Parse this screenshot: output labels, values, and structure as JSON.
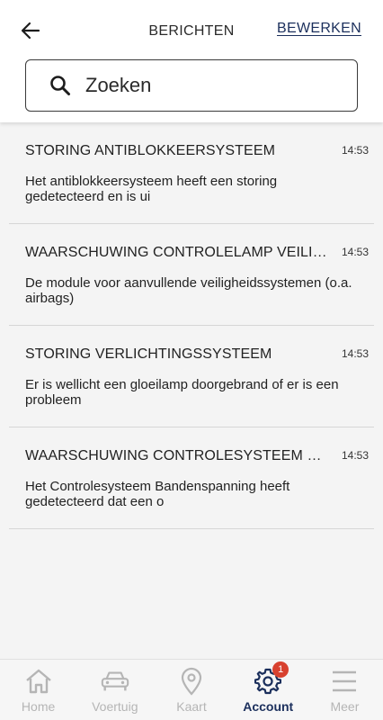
{
  "header": {
    "title": "BERICHTEN",
    "edit_label": "BEWERKEN",
    "back_icon": "arrow-left-icon"
  },
  "search": {
    "placeholder": "Zoeken",
    "value": "",
    "icon": "search-icon"
  },
  "messages": [
    {
      "title": "STORING ANTIBLOKKEERSYSTEEM",
      "time": "14:53",
      "body": "Het antiblokkeersysteem heeft een storing gedetecteerd en is ui"
    },
    {
      "title": "WAARSCHUWING CONTROLELAMP VEILIGHEIDS...",
      "time": "14:53",
      "body": "De module  voor aanvullende veiligheidssystemen (o.a. airbags)"
    },
    {
      "title": "STORING VERLICHTINGSSYSTEEM",
      "time": "14:53",
      "body": "Er is wellicht een gloeilamp doorgebrand of er is een probleem"
    },
    {
      "title": "WAARSCHUWING CONTROLESYSTEEM BANDEN...",
      "time": "14:53",
      "body": "Het Controlesysteem Bandenspanning heeft gedetecteerd dat een o"
    }
  ],
  "nav": {
    "items": [
      {
        "label": "Home",
        "icon": "home-icon"
      },
      {
        "label": "Voertuig",
        "icon": "car-icon"
      },
      {
        "label": "Kaart",
        "icon": "map-pin-icon"
      },
      {
        "label": "Account",
        "icon": "gear-icon",
        "badge": "1",
        "active": true
      },
      {
        "label": "Meer",
        "icon": "menu-icon"
      }
    ]
  },
  "colors": {
    "accent": "#1b2f5c",
    "badge": "#d8412f",
    "inactive": "#b5b5b5"
  }
}
